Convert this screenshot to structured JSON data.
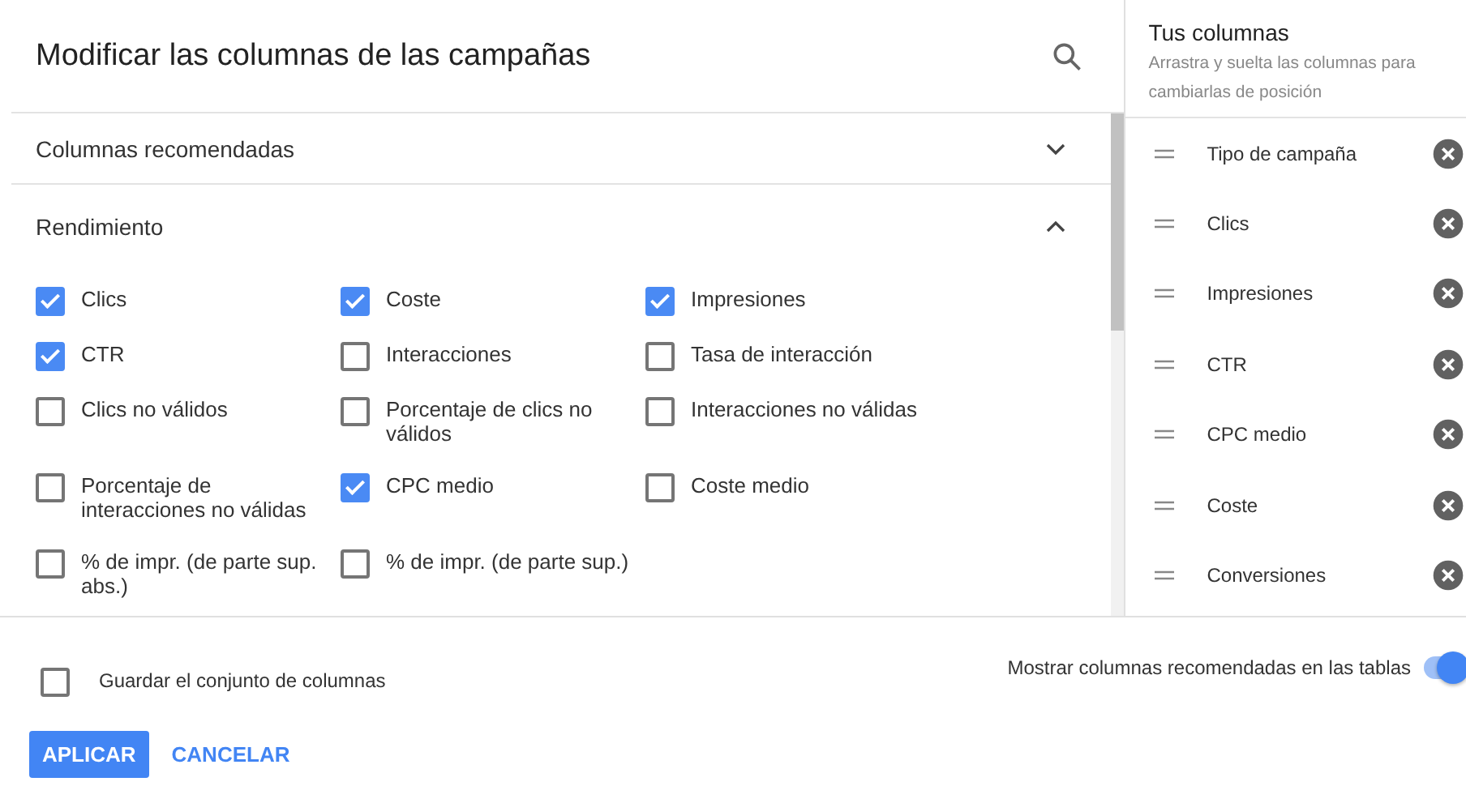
{
  "dialog": {
    "title": "Modificar las columnas de las campañas"
  },
  "sections": [
    {
      "title": "Columnas recomendadas",
      "expanded": false
    },
    {
      "title": "Rendimiento",
      "expanded": true,
      "options": [
        {
          "label": "Clics",
          "checked": true
        },
        {
          "label": "Coste",
          "checked": true
        },
        {
          "label": "Impresiones",
          "checked": true
        },
        {
          "label": "CTR",
          "checked": true
        },
        {
          "label": "Interacciones",
          "checked": false
        },
        {
          "label": "Tasa de interacción",
          "checked": false
        },
        {
          "label": "Clics no válidos",
          "checked": false
        },
        {
          "label": "Porcentaje de clics no válidos",
          "checked": false
        },
        {
          "label": "Interacciones no válidas",
          "checked": false
        },
        {
          "label": "Porcentaje de interacciones no válidas",
          "checked": false
        },
        {
          "label": "CPC medio",
          "checked": true
        },
        {
          "label": "Coste medio",
          "checked": false
        },
        {
          "label": "% de impr. (de parte sup. abs.)",
          "checked": false
        },
        {
          "label": "% de impr. (de parte sup.)",
          "checked": false
        }
      ]
    }
  ],
  "your_columns": {
    "title": "Tus columnas",
    "hint": "Arrastra y suelta las columnas para cambiarlas de posición",
    "items": [
      "Tipo de campaña",
      "Clics",
      "Impresiones",
      "CTR",
      "CPC medio",
      "Coste",
      "Conversiones"
    ]
  },
  "save_set": {
    "label": "Guardar el conjunto de columnas",
    "checked": false
  },
  "show_recommended": {
    "label": "Mostrar columnas recomendadas en las tablas",
    "on": true
  },
  "buttons": [
    {
      "label": "APLICAR",
      "kind": "primary"
    },
    {
      "label": "CANCELAR",
      "kind": "text"
    }
  ]
}
